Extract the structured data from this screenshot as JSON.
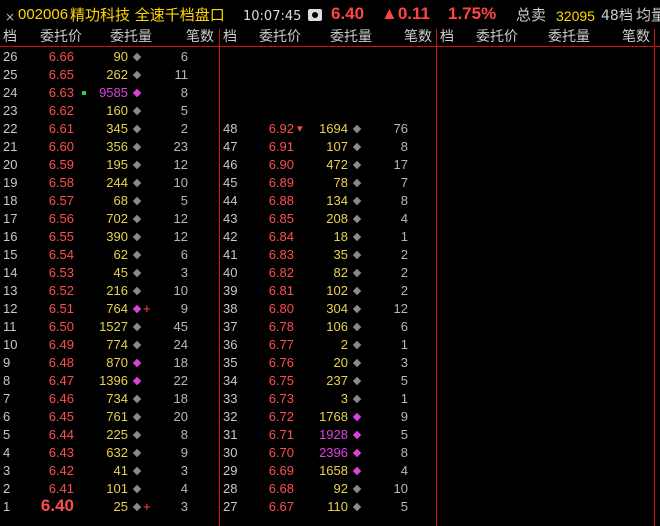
{
  "title_bar": {
    "close_symbol": "×",
    "stock_code": "002006",
    "stock_name": "精功科技 全速千档盘口",
    "time": "10:07:45",
    "camera_icon": "camera-icon",
    "price": "6.40",
    "change": "▲0.11",
    "change_pct": "1.75%",
    "total_sell_label": "总卖",
    "total_sell_value": "32095",
    "levels": "48档",
    "avg_label": "均量"
  },
  "columns": {
    "level": "档",
    "price": "委托价",
    "volume": "委托量",
    "count": "笔数"
  },
  "colors": {
    "price": "#ff4d4d",
    "volume": "#e8d24a",
    "large_volume": "#e040e0",
    "divider": "#d01010"
  },
  "panel1": [
    {
      "level": "26",
      "price": "6.66",
      "volume": "90",
      "diamond": "gray",
      "count": "6"
    },
    {
      "level": "25",
      "price": "6.65",
      "volume": "262",
      "diamond": "gray",
      "count": "11"
    },
    {
      "level": "24",
      "price": "6.63",
      "volume": "9585",
      "diamond": "magenta",
      "count": "8",
      "big": true,
      "pre_mark": "green-dot"
    },
    {
      "level": "23",
      "price": "6.62",
      "volume": "160",
      "diamond": "gray",
      "count": "5"
    },
    {
      "level": "22",
      "price": "6.61",
      "volume": "345",
      "diamond": "gray",
      "count": "2"
    },
    {
      "level": "21",
      "price": "6.60",
      "volume": "356",
      "diamond": "gray",
      "count": "23"
    },
    {
      "level": "20",
      "price": "6.59",
      "volume": "195",
      "diamond": "gray",
      "count": "12"
    },
    {
      "level": "19",
      "price": "6.58",
      "volume": "244",
      "diamond": "gray",
      "count": "10"
    },
    {
      "level": "18",
      "price": "6.57",
      "volume": "68",
      "diamond": "gray",
      "count": "5"
    },
    {
      "level": "17",
      "price": "6.56",
      "volume": "702",
      "diamond": "gray",
      "count": "12"
    },
    {
      "level": "16",
      "price": "6.55",
      "volume": "390",
      "diamond": "gray",
      "count": "12"
    },
    {
      "level": "15",
      "price": "6.54",
      "volume": "62",
      "diamond": "gray",
      "count": "6"
    },
    {
      "level": "14",
      "price": "6.53",
      "volume": "45",
      "diamond": "gray",
      "count": "3"
    },
    {
      "level": "13",
      "price": "6.52",
      "volume": "216",
      "diamond": "gray",
      "count": "10"
    },
    {
      "level": "12",
      "price": "6.51",
      "volume": "764",
      "diamond": "magenta",
      "count": "9",
      "post_mark": "+"
    },
    {
      "level": "11",
      "price": "6.50",
      "volume": "1527",
      "diamond": "gray",
      "count": "45"
    },
    {
      "level": "10",
      "price": "6.49",
      "volume": "774",
      "diamond": "gray",
      "count": "24"
    },
    {
      "level": "9",
      "price": "6.48",
      "volume": "870",
      "diamond": "magenta",
      "count": "18"
    },
    {
      "level": "8",
      "price": "6.47",
      "volume": "1396",
      "diamond": "magenta",
      "count": "22"
    },
    {
      "level": "7",
      "price": "6.46",
      "volume": "734",
      "diamond": "gray",
      "count": "18"
    },
    {
      "level": "6",
      "price": "6.45",
      "volume": "761",
      "diamond": "gray",
      "count": "20"
    },
    {
      "level": "5",
      "price": "6.44",
      "volume": "225",
      "diamond": "gray",
      "count": "8"
    },
    {
      "level": "4",
      "price": "6.43",
      "volume": "632",
      "diamond": "gray",
      "count": "9"
    },
    {
      "level": "3",
      "price": "6.42",
      "volume": "41",
      "diamond": "gray",
      "count": "3"
    },
    {
      "level": "2",
      "price": "6.41",
      "volume": "101",
      "diamond": "gray",
      "count": "4"
    },
    {
      "level": "1",
      "price": "6.40",
      "volume": "25",
      "diamond": "gray",
      "count": "3",
      "post_mark": "+",
      "current": true
    }
  ],
  "panel2": [
    {
      "level": "48",
      "price": "6.92",
      "volume": "1694",
      "diamond": "gray",
      "count": "76",
      "pre_mark": "▾"
    },
    {
      "level": "47",
      "price": "6.91",
      "volume": "107",
      "diamond": "gray",
      "count": "8"
    },
    {
      "level": "46",
      "price": "6.90",
      "volume": "472",
      "diamond": "gray",
      "count": "17"
    },
    {
      "level": "45",
      "price": "6.89",
      "volume": "78",
      "diamond": "gray",
      "count": "7"
    },
    {
      "level": "44",
      "price": "6.88",
      "volume": "134",
      "diamond": "gray",
      "count": "8"
    },
    {
      "level": "43",
      "price": "6.85",
      "volume": "208",
      "diamond": "gray",
      "count": "4"
    },
    {
      "level": "42",
      "price": "6.84",
      "volume": "18",
      "diamond": "gray",
      "count": "1"
    },
    {
      "level": "41",
      "price": "6.83",
      "volume": "35",
      "diamond": "gray",
      "count": "2"
    },
    {
      "level": "40",
      "price": "6.82",
      "volume": "82",
      "diamond": "gray",
      "count": "2"
    },
    {
      "level": "39",
      "price": "6.81",
      "volume": "102",
      "diamond": "gray",
      "count": "2"
    },
    {
      "level": "38",
      "price": "6.80",
      "volume": "304",
      "diamond": "gray",
      "count": "12"
    },
    {
      "level": "37",
      "price": "6.78",
      "volume": "106",
      "diamond": "gray",
      "count": "6"
    },
    {
      "level": "36",
      "price": "6.77",
      "volume": "2",
      "diamond": "gray",
      "count": "1"
    },
    {
      "level": "35",
      "price": "6.76",
      "volume": "20",
      "diamond": "gray",
      "count": "3"
    },
    {
      "level": "34",
      "price": "6.75",
      "volume": "237",
      "diamond": "gray",
      "count": "5"
    },
    {
      "level": "33",
      "price": "6.73",
      "volume": "3",
      "diamond": "gray",
      "count": "1"
    },
    {
      "level": "32",
      "price": "6.72",
      "volume": "1768",
      "diamond": "magenta",
      "count": "9"
    },
    {
      "level": "31",
      "price": "6.71",
      "volume": "1928",
      "diamond": "magenta",
      "count": "5",
      "big": true
    },
    {
      "level": "30",
      "price": "6.70",
      "volume": "2396",
      "diamond": "magenta",
      "count": "8",
      "big": true
    },
    {
      "level": "29",
      "price": "6.69",
      "volume": "1658",
      "diamond": "magenta",
      "count": "4"
    },
    {
      "level": "28",
      "price": "6.68",
      "volume": "92",
      "diamond": "gray",
      "count": "10"
    },
    {
      "level": "27",
      "price": "6.67",
      "volume": "110",
      "diamond": "gray",
      "count": "5"
    }
  ]
}
